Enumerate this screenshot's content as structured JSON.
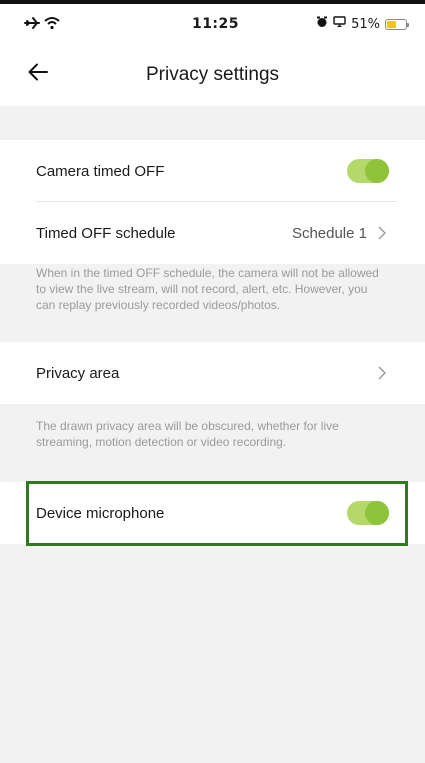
{
  "status_bar": {
    "time": "11:25",
    "battery_percent": "51%",
    "battery_level": 0.51,
    "airplane_icon": "airplane-icon",
    "wifi_icon": "wifi-icon",
    "colors": {
      "battery_fill": "#f3c316"
    }
  },
  "nav": {
    "title": "Privacy settings",
    "back_icon": "back-arrow-icon"
  },
  "section1": {
    "camera_timed_off": {
      "label": "Camera timed OFF",
      "enabled": true
    },
    "timed_off_schedule": {
      "label": "Timed OFF schedule",
      "value": "Schedule 1"
    },
    "note": "When in the timed OFF schedule, the camera will not be allowed to view the live stream, will not record, alert, etc. However, you can replay previously recorded videos/photos."
  },
  "section2": {
    "privacy_area": {
      "label": "Privacy area"
    },
    "note": "The drawn privacy area will be obscured, whether for live streaming, motion detection or video recording."
  },
  "section3": {
    "device_microphone": {
      "label": "Device microphone",
      "enabled": true
    }
  },
  "colors": {
    "toggle_track": "#b5d86a",
    "toggle_knob": "#8fc33a",
    "highlight_border": "#2f7a1e"
  }
}
